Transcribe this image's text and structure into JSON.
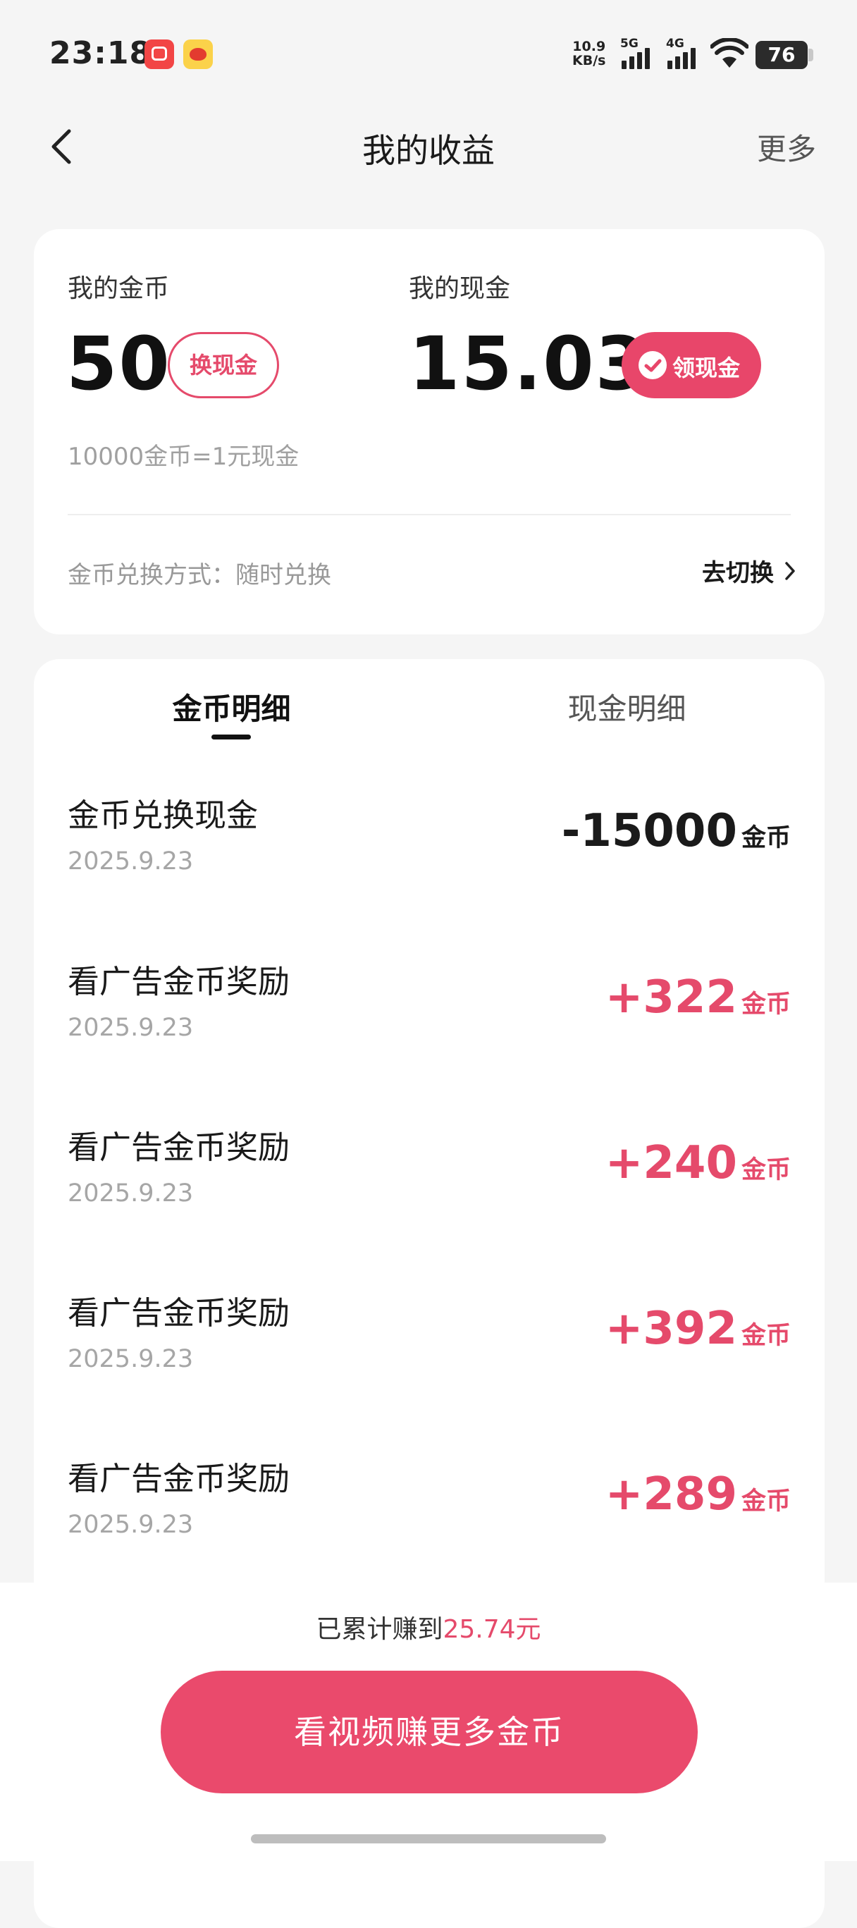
{
  "status_bar": {
    "time": "23:18",
    "net_speed_value": "10.9",
    "net_speed_unit": "KB/s",
    "sim1": "5G",
    "sim2": "4G",
    "battery": "76"
  },
  "nav": {
    "title": "我的收益",
    "more": "更多"
  },
  "balance": {
    "coins_label": "我的金币",
    "coins_value": "50",
    "exchange_btn": "换现金",
    "cash_label": "我的现金",
    "cash_value": "15.03",
    "withdraw_btn": "领现金",
    "rate_text": "10000金币=1元现金",
    "exchange_mode": "金币兑换方式：随时兑换",
    "switch_label": "去切换"
  },
  "tabs": [
    {
      "label": "金币明细",
      "active": true
    },
    {
      "label": "现金明细",
      "active": false
    }
  ],
  "records": [
    {
      "title": "金币兑换现金",
      "date": "2025.9.23",
      "amount": "-15000",
      "unit": "金币",
      "color": "#1a1a1a"
    },
    {
      "title": "看广告金币奖励",
      "date": "2025.9.23",
      "amount": "+322",
      "unit": "金币",
      "color": "#e54a6b"
    },
    {
      "title": "看广告金币奖励",
      "date": "2025.9.23",
      "amount": "+240",
      "unit": "金币",
      "color": "#e54a6b"
    },
    {
      "title": "看广告金币奖励",
      "date": "2025.9.23",
      "amount": "+392",
      "unit": "金币",
      "color": "#e54a6b"
    },
    {
      "title": "看广告金币奖励",
      "date": "2025.9.23",
      "amount": "+289",
      "unit": "金币",
      "color": "#e54a6b"
    }
  ],
  "footer": {
    "total_prefix": "已累计赚到",
    "total_amount": "25.74元",
    "cta": "看视频赚更多金币"
  },
  "colors": {
    "accent": "#e8466a",
    "background": "#f5f5f5"
  }
}
